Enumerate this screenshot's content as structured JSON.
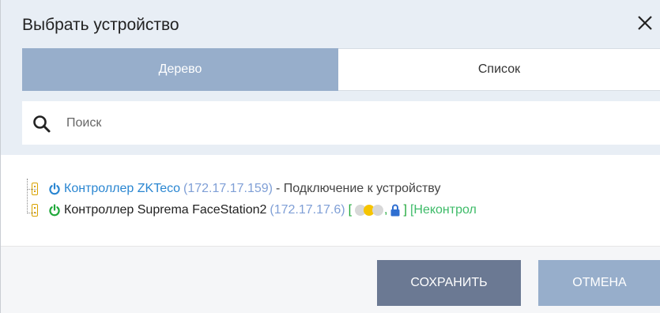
{
  "dialog": {
    "title": "Выбрать устройство",
    "close_icon": "close-icon"
  },
  "tabs": [
    {
      "label": "Дерево",
      "active": true
    },
    {
      "label": "Список",
      "active": false
    }
  ],
  "search": {
    "placeholder": "Поиск",
    "value": "",
    "icon": "search-icon"
  },
  "tree": {
    "items": [
      {
        "name": "Контроллер ZKTeco",
        "ip": "(172.17.17.159)",
        "status": "- Подключение к устройству",
        "power_color": "#2a86d1"
      },
      {
        "name": "Контроллер Suprema FaceStation2",
        "ip": "(172.17.17.6)",
        "bracket_open": "[",
        "comma": ",",
        "bracket_close": "]",
        "uncontrolled": "[Неконтрол",
        "power_color": "#1fa83a"
      }
    ]
  },
  "footer": {
    "save_label": "СОХРАНИТЬ",
    "cancel_label": "ОТМЕНА"
  },
  "colors": {
    "header_bg": "#e8eef5",
    "tab_active": "#97aecb",
    "save_button": "#6b7993",
    "cancel_button": "#97aecb",
    "link_blue": "#2a86d1",
    "ip_blue": "#7f9fd6",
    "green": "#1fa83a"
  }
}
